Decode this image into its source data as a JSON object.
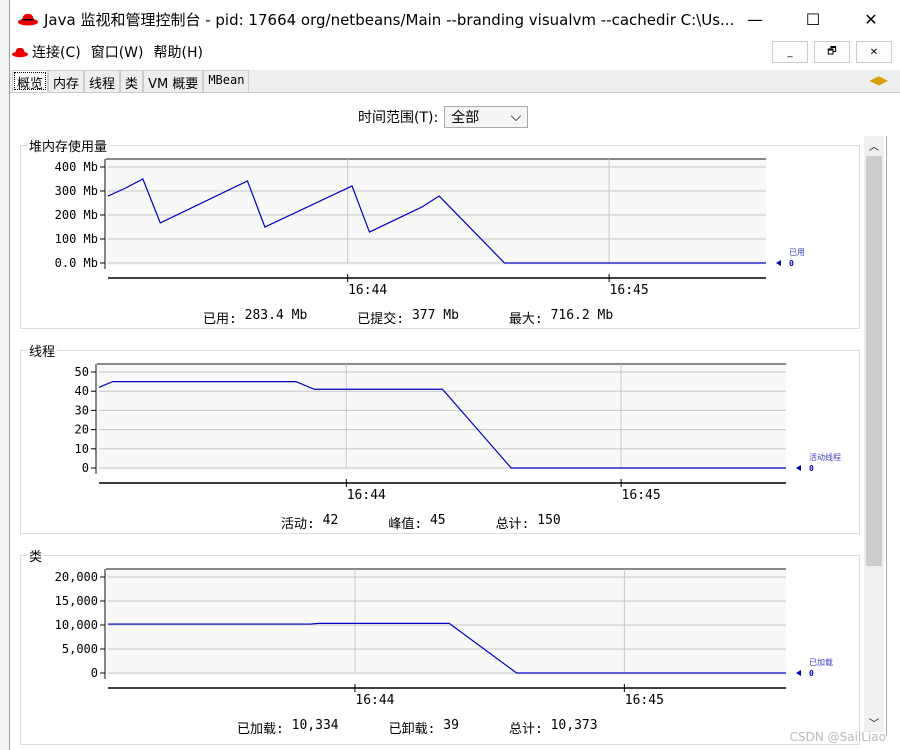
{
  "window": {
    "title": "Java 监视和管理控制台 - pid: 17664 org/netbeans/Main --branding visualvm --cachedir C:\\Us...",
    "minimize": "—",
    "maximize": "☐",
    "close": "✕"
  },
  "menu": [
    "连接(C)",
    "窗口(W)",
    "帮助(H)"
  ],
  "mdi": [
    "_",
    "🗗",
    "✕"
  ],
  "tabs": [
    "概览",
    "内存",
    "线程",
    "类",
    "VM 概要",
    "MBean"
  ],
  "time_range": {
    "label": "时间范围(T):",
    "value": "全部"
  },
  "watermark": "CSDN @SailLiao",
  "colors": {
    "series": "#0000c0",
    "grid": "#c8c8c8"
  },
  "panels": [
    {
      "title": "堆内存使用量",
      "stats": [
        [
          "已用: ",
          "283.4 Mb"
        ],
        [
          "已提交: ",
          "377 Mb"
        ],
        [
          "最大: ",
          "716.2 Mb"
        ]
      ]
    },
    {
      "title": "线程",
      "stats": [
        [
          "活动: ",
          "42"
        ],
        [
          "峰值: ",
          "45"
        ],
        [
          "总计: ",
          "150"
        ]
      ]
    },
    {
      "title": "类",
      "stats": [
        [
          "已加载: ",
          "10,334"
        ],
        [
          "已卸载: ",
          "39"
        ],
        [
          "总计: ",
          "10,373"
        ]
      ]
    }
  ],
  "chart_data": [
    {
      "type": "line",
      "yticks": [
        "400 Mb",
        "300 Mb",
        "200 Mb",
        "100 Mb",
        "0.0 Mb"
      ],
      "ylim": [
        0,
        400
      ],
      "xticks": [
        "16:44",
        "16:45"
      ],
      "xlim": [
        "16:43:05",
        "16:45:36"
      ],
      "series": [
        {
          "name": "已用",
          "last": "0",
          "x": [
            "16:43:05",
            "16:43:09",
            "16:43:13",
            "16:43:17",
            "16:43:37",
            "16:43:41",
            "16:44:01",
            "16:44:05",
            "16:44:17",
            "16:44:21",
            "16:44:36",
            "16:45:36"
          ],
          "y": [
            279,
            312,
            350,
            167,
            342,
            150,
            321,
            129,
            233,
            279,
            0,
            0
          ]
        }
      ]
    },
    {
      "type": "line",
      "yticks": [
        "50",
        "40",
        "30",
        "20",
        "10",
        "0"
      ],
      "ylim": [
        0,
        50
      ],
      "xticks": [
        "16:44",
        "16:45"
      ],
      "xlim": [
        "16:43:06",
        "16:45:36"
      ],
      "series": [
        {
          "name": "活动线程",
          "last": "0",
          "x": [
            "16:43:06",
            "16:43:09",
            "16:43:49",
            "16:43:53",
            "16:44:21",
            "16:44:36",
            "16:45:36"
          ],
          "y": [
            42,
            45,
            45,
            41,
            41,
            0,
            0
          ]
        }
      ]
    },
    {
      "type": "line",
      "yticks": [
        "20,000",
        "15,000",
        "10,000",
        "5,000",
        "0"
      ],
      "ylim": [
        0,
        20000
      ],
      "xticks": [
        "16:44",
        "16:45"
      ],
      "xlim": [
        "16:43:05",
        "16:45:36"
      ],
      "series": [
        {
          "name": "已加载",
          "last": "0",
          "x": [
            "16:43:05",
            "16:43:50",
            "16:43:52",
            "16:44:21",
            "16:44:36",
            "16:45:36"
          ],
          "y": [
            10200,
            10200,
            10334,
            10334,
            0,
            0
          ]
        }
      ]
    }
  ]
}
